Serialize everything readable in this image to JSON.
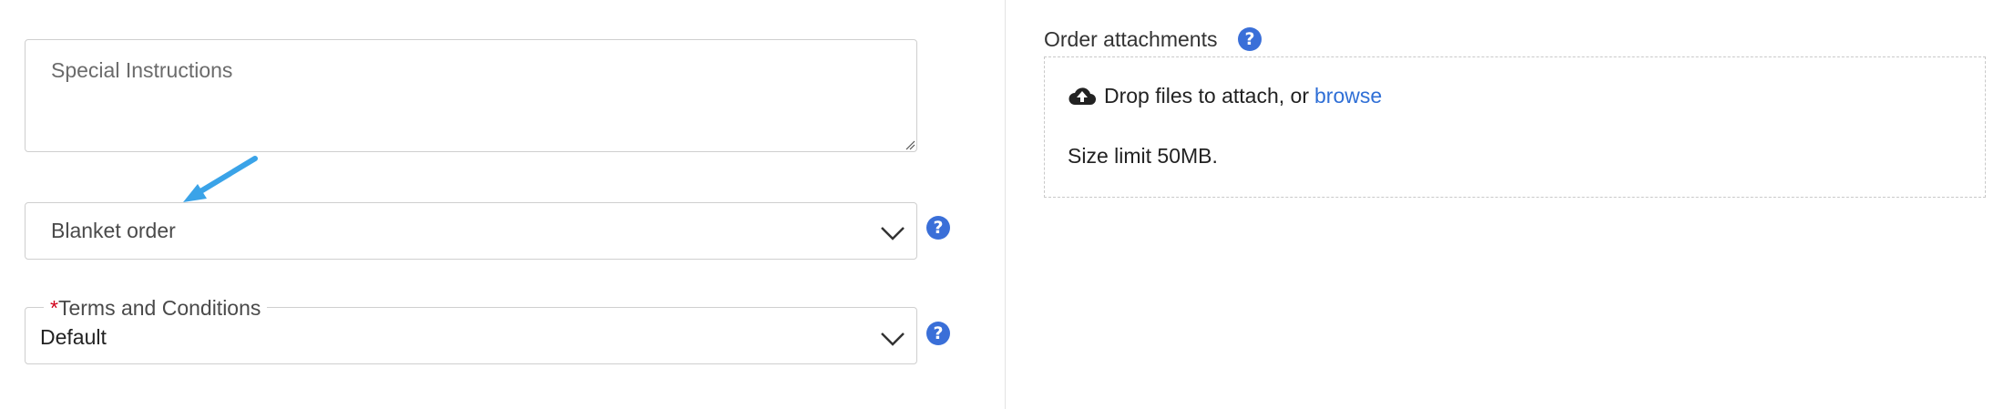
{
  "special_instructions": {
    "placeholder": "Special Instructions"
  },
  "order_type": {
    "selected": "Blanket order"
  },
  "terms": {
    "label": "Terms and Conditions",
    "required_marker": "*",
    "selected": "Default"
  },
  "attachments": {
    "label": "Order attachments",
    "drop_text": "Drop files to attach, or",
    "browse_label": "browse",
    "size_limit": "Size limit 50MB."
  },
  "help_icon_glyph": "?",
  "colors": {
    "accent": "#3a6fd8",
    "link": "#2f6fd6",
    "required": "#d0021b",
    "arrow": "#3aa3e8",
    "border": "#cfcfcf"
  },
  "icons": [
    "resize-grip-icon",
    "arrow-pointer-icon",
    "chevron-down-icon",
    "help-icon",
    "cloud-upload-icon"
  ]
}
